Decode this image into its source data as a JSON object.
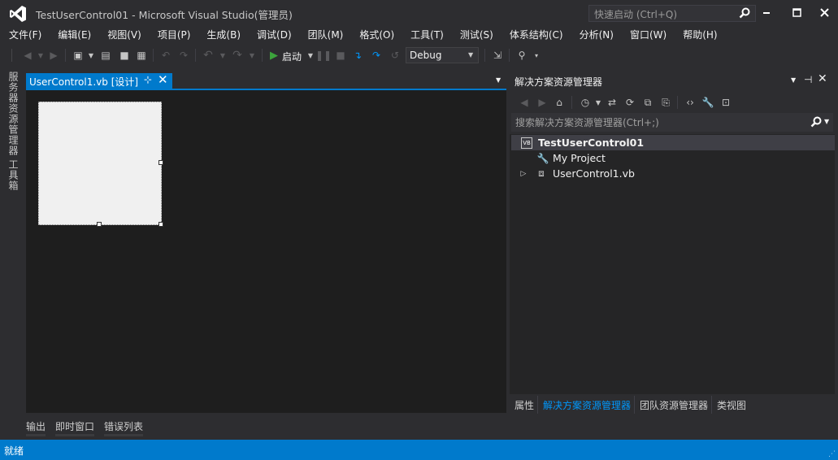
{
  "window": {
    "title": "TestUserControl01 - Microsoft Visual Studio(管理员)",
    "quick_launch_placeholder": "快速启动 (Ctrl+Q)"
  },
  "menu": [
    "文件(F)",
    "编辑(E)",
    "视图(V)",
    "项目(P)",
    "生成(B)",
    "调试(D)",
    "团队(M)",
    "格式(O)",
    "工具(T)",
    "测试(S)",
    "体系结构(C)",
    "分析(N)",
    "窗口(W)",
    "帮助(H)"
  ],
  "toolbar": {
    "start_label": "启动",
    "configuration": "Debug"
  },
  "left_strip": {
    "server_explorer": "服务器资源管理器",
    "toolbox": "工具箱"
  },
  "document": {
    "tab_label": "UserControl1.vb [设计]"
  },
  "solution_explorer": {
    "title": "解决方案资源管理器",
    "search_placeholder": "搜索解决方案资源管理器(Ctrl+;)",
    "tree": [
      {
        "label": "TestUserControl01",
        "icon": "vb-project-icon",
        "selected": true
      },
      {
        "label": "My Project",
        "icon": "wrench-icon"
      },
      {
        "label": "UserControl1.vb",
        "icon": "usercontrol-file-icon",
        "expandable": true
      }
    ],
    "bottom_tabs": [
      "属性",
      "解决方案资源管理器",
      "团队资源管理器",
      "类视图"
    ]
  },
  "bottom_tabs": [
    "输出",
    "即时窗口",
    "错误列表"
  ],
  "status": {
    "text": "就绪"
  },
  "colors": {
    "accent": "#007acc",
    "background": "#2d2d30",
    "designer": "#1e1e1e",
    "active_tab_text": "#0097fb"
  }
}
